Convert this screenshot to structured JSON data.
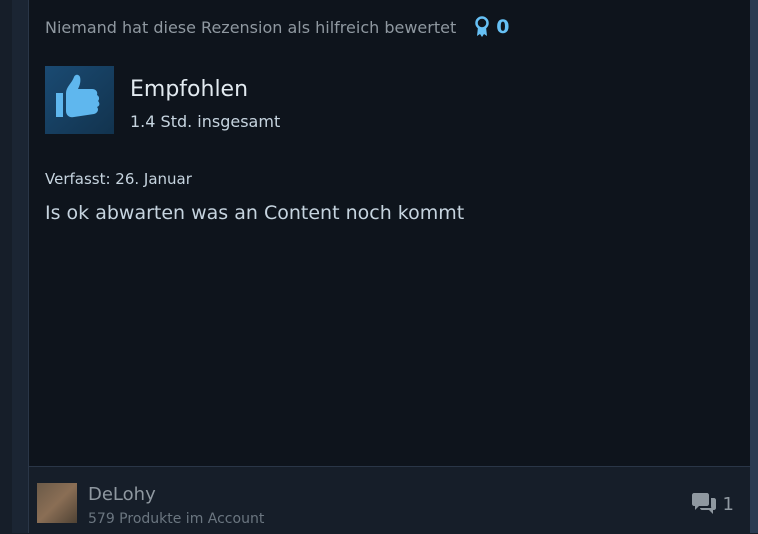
{
  "review": {
    "helpful_text": "Niemand hat diese Rezension als hilfreich bewertet",
    "award_count": "0",
    "recommendation": "Empfohlen",
    "hours": "1.4 Std. insgesamt",
    "posted": "Verfasst: 26. Januar",
    "text": "Is ok abwarten was an Content noch kommt"
  },
  "author": {
    "name": "DeLohy",
    "products": "579 Produkte im Account"
  },
  "comments": {
    "count": "1"
  },
  "icons": {
    "award": "award-ribbon-icon",
    "recommendation": "thumbs-up-icon",
    "comments": "comment-bubbles-icon"
  },
  "colors": {
    "accent": "#66c0f4",
    "background": "#0e141c",
    "muted_text": "#8f98a0"
  }
}
